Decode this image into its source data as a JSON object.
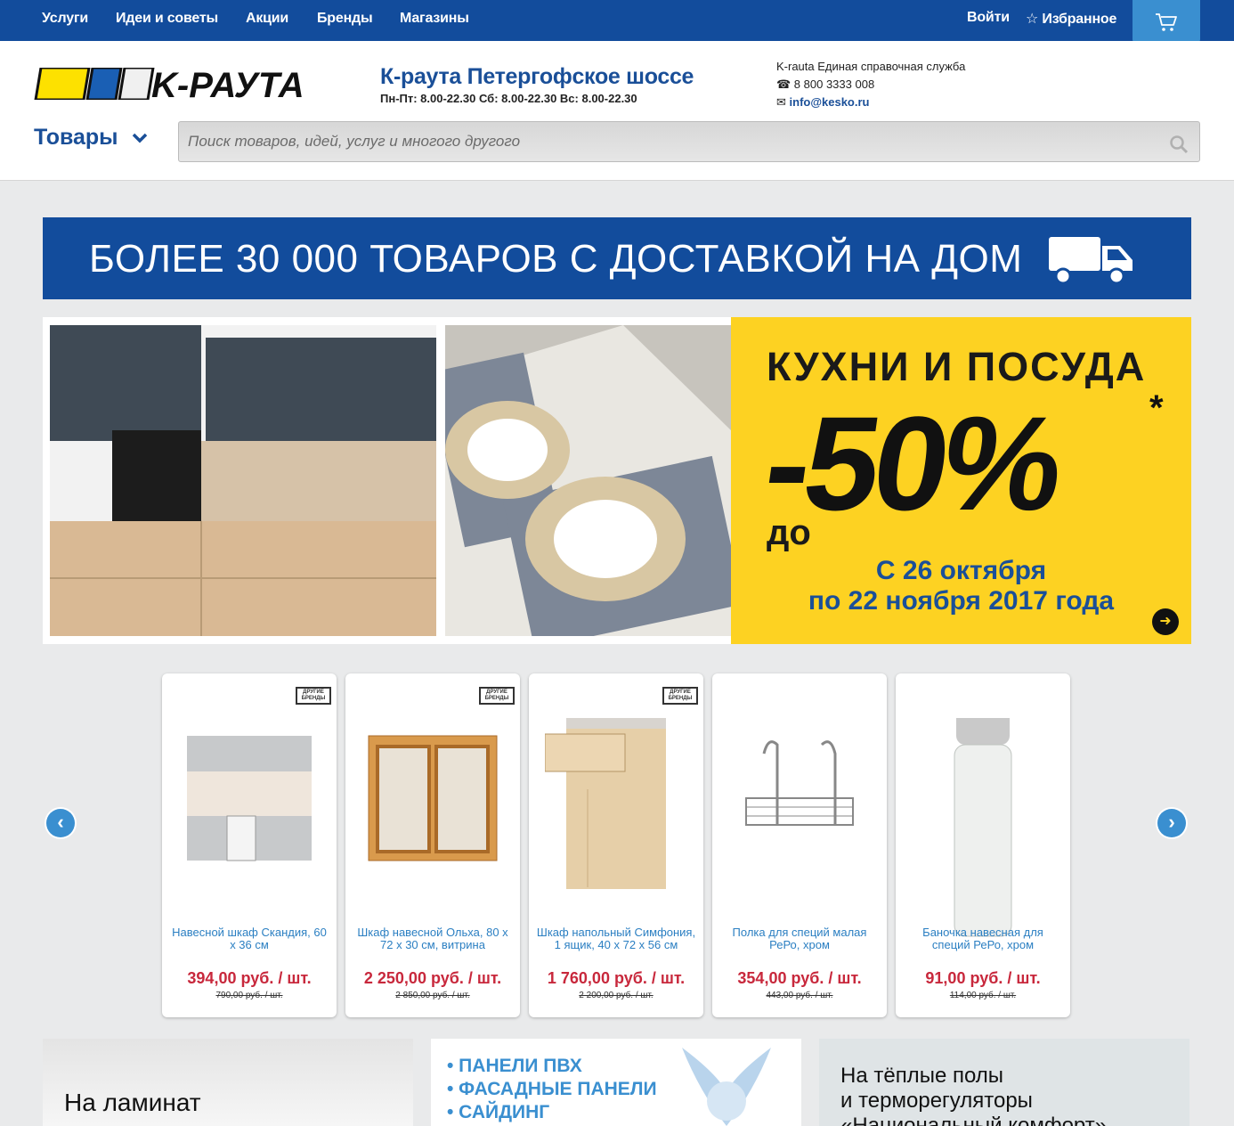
{
  "nav": {
    "services": "Услуги",
    "ideas": "Идеи и советы",
    "promotions": "Акции",
    "brands": "Бренды",
    "stores": "Магазины",
    "login": "Войти",
    "favorites": "☆ Избранное"
  },
  "header": {
    "logo_text": "K-РАУТА",
    "store_name": "К-раута Петергофское шоссе",
    "store_hours": "Пн-Пт: 8.00-22.30 Сб: 8.00-22.30 Вс: 8.00-22.30",
    "contact_title": "K-rauta Единая справочная служба",
    "phone": "☎ 8 800 3333 008",
    "email_prefix": "✉ ",
    "email": "info@kesko.ru",
    "goods_label": "Товары",
    "search_placeholder": "Поиск товаров, идей, услуг и многого другого"
  },
  "delivery_banner": {
    "text": "БОЛЕЕ 30 000 ТОВАРОВ С ДОСТАВКОЙ НА ДОМ"
  },
  "promo": {
    "title": "КУХНИ И ПОСУДА",
    "prefix": "до",
    "discount": "-50%",
    "star": "*",
    "date_line1": "С 26 октября",
    "date_line2": "по 22 ноября 2017 года"
  },
  "products": [
    {
      "name": "Навесной шкаф Скандия, 60 х 36 см",
      "price": "394,00 руб. / шт.",
      "old_price": "790,00 руб. / шт.",
      "badge": "ДРУГИЕ БРЕНДЫ"
    },
    {
      "name": "Шкаф навесной Ольха, 80 х 72 х 30 см, витрина",
      "price": "2 250,00 руб. / шт.",
      "old_price": "2 850,00 руб. / шт.",
      "badge": "ДРУГИЕ БРЕНДЫ"
    },
    {
      "name": "Шкаф напольный Симфония, 1 ящик, 40 х 72 х 56 см",
      "price": "1 760,00 руб. / шт.",
      "old_price": "2 200,00 руб. / шт.",
      "badge": "ДРУГИЕ БРЕНДЫ"
    },
    {
      "name": "Полка для специй малая РеРо, хром",
      "price": "354,00 руб. / шт.",
      "old_price": "443,00 руб. / шт.",
      "badge": ""
    },
    {
      "name": "Баночка навесная для специй РеРо, хром",
      "price": "91,00 руб. / шт.",
      "old_price": "114,00 руб. / шт.",
      "badge": ""
    }
  ],
  "tiles": {
    "laminate": "На ламинат",
    "panels": [
      "• ПАНЕЛИ ПВХ",
      "• ФАСАДНЫЕ ПАНЕЛИ",
      "• САЙДИНГ"
    ],
    "floors_line1": "На тёплые полы",
    "floors_line2": "и терморегуляторы",
    "floors_line3": "«Национальный комфорт»"
  },
  "colors": {
    "brand_blue": "#124c9c",
    "accent_blue": "#3a8fd0",
    "promo_yellow": "#fdd222",
    "price_red": "#c8283c"
  }
}
